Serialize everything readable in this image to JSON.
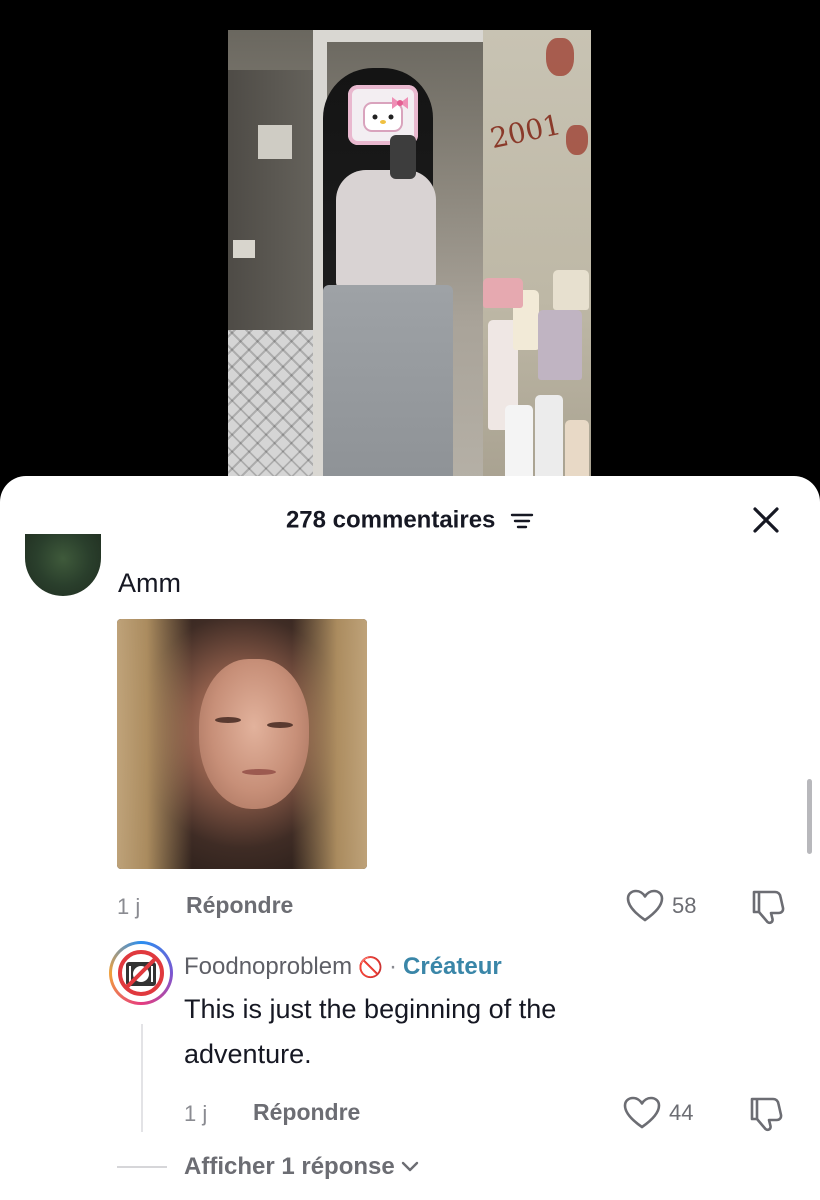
{
  "sheet": {
    "comment_count_label": "278 commentaires"
  },
  "comments": [
    {
      "text": "Amm",
      "image": "sad-face-meme",
      "time": "1 j",
      "reply_label": "Répondre",
      "likes": "58"
    }
  ],
  "reply": {
    "username": "Foodnoproblem",
    "username_emoji": "🚫",
    "separator": "·",
    "badge": "Créateur",
    "text_line1": "This is just the beginning of the",
    "text_line2": "adventure.",
    "time": "1 j",
    "reply_label": "Répondre",
    "likes": "44"
  },
  "show_more_replies": "Afficher 1 réponse",
  "video_overlay_text": "2001",
  "colors": {
    "creator_badge": "#3a86a8",
    "text_primary": "#161823",
    "text_secondary": "#6c6d73"
  },
  "icons": [
    "filter-icon",
    "close-icon",
    "heart-icon",
    "dislike-icon",
    "chevron-down-icon",
    "no-food-avatar-icon"
  ]
}
